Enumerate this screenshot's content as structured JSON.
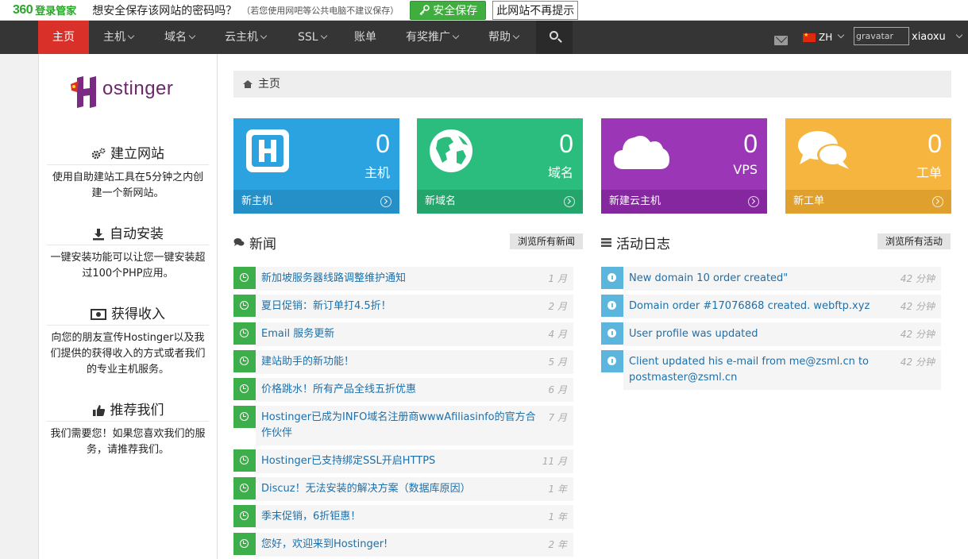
{
  "pwbar": {
    "logo": "360",
    "logo_sub": "登录管家",
    "message": "想安全保存该网站的密码吗？",
    "hint": "（若您使用网吧等公共电脑不建议保存）",
    "save_label": "安全保存",
    "never_label": "此网站不再提示"
  },
  "nav": {
    "items": [
      {
        "label": "主页"
      },
      {
        "label": "主机"
      },
      {
        "label": "域名"
      },
      {
        "label": "云主机"
      },
      {
        "label": "SSL"
      },
      {
        "label": "账单"
      },
      {
        "label": "有奖推广"
      },
      {
        "label": "帮助"
      }
    ],
    "language": "ZH",
    "avatar_alt": "gravatar",
    "username": "xiaoxu"
  },
  "sidebar": {
    "brand": "ostinger",
    "sections": [
      {
        "title": "建立网站",
        "desc": "使用自助建站工具在5分钟之内创建一个新网站。"
      },
      {
        "title": "自动安装",
        "desc": "一键安装功能可以让您一键安装超过100个PHP应用。"
      },
      {
        "title": "获得收入",
        "desc": "向您的朋友宣传Hostinger以及我们提供的获得收入的方式或者我们的专业主机服务。"
      },
      {
        "title": "推荐我们",
        "desc": "我们需要您！如果您喜欢我们的服务，请推荐我们。"
      }
    ]
  },
  "main": {
    "breadcrumb": "主页",
    "tiles": [
      {
        "count": "0",
        "label": "主机",
        "footer": "新主机",
        "color": "#2ba3e0",
        "footer_color": "#2590c8"
      },
      {
        "count": "0",
        "label": "域名",
        "footer": "新域名",
        "color": "#2bbd7e",
        "footer_color": "#24a56c"
      },
      {
        "count": "0",
        "label": "VPS",
        "footer": "新建云主机",
        "color": "#9b36b7",
        "footer_color": "#85279f"
      },
      {
        "count": "0",
        "label": "工单",
        "footer": "新工单",
        "color": "#f5b53f",
        "footer_color": "#dfa02e"
      }
    ],
    "news": {
      "title": "新闻",
      "button": "浏览所有新闻",
      "items": [
        {
          "text": "新加坡服务器线路调整维护通知",
          "time": "1 月"
        },
        {
          "text": "夏日促销：新订单打4.5折！",
          "time": "2 月"
        },
        {
          "text": "Email 服务更新",
          "time": "4 月"
        },
        {
          "text": "建站助手的新功能！",
          "time": "5 月"
        },
        {
          "text": "价格跳水！所有产品全线五折优惠",
          "time": "6 月"
        },
        {
          "text": "Hostinger已成为INFO域名注册商wwwAfiliasinfo的官方合作伙伴",
          "time": "7 月"
        },
        {
          "text": "Hostinger已支持绑定SSL开启HTTPS",
          "time": "11 月"
        },
        {
          "text": "Discuz！无法安装的解决方案（数据库原因）",
          "time": "1 年"
        },
        {
          "text": "季末促销，6折钜惠！",
          "time": "1 年"
        },
        {
          "text": "您好，欢迎来到Hostinger!",
          "time": "2 年"
        }
      ]
    },
    "activity": {
      "title": "活动日志",
      "button": "浏览所有活动",
      "items": [
        {
          "text": "New domain 10 order created\"",
          "time": "42 分钟",
          "icon": "info-icon"
        },
        {
          "text": "Domain order #17076868 created. webftp.xyz",
          "time": "42 分钟",
          "icon": "globe-icon"
        },
        {
          "text": "User profile was updated",
          "time": "42 分钟",
          "icon": "info-icon"
        },
        {
          "text": "Client updated his e-mail from me@zsml.cn to postmaster@zsml.cn",
          "time": "42 分钟",
          "icon": "info-icon"
        }
      ]
    }
  }
}
